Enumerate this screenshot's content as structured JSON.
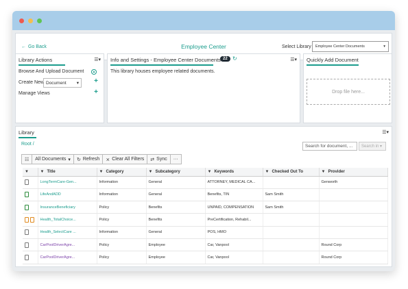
{
  "titlebar": {},
  "topbar": {
    "back_label": "Go Back",
    "title": "Employee Center",
    "select_library_label": "Select Library",
    "select_library_value": "Employee Center Documents"
  },
  "library_actions": {
    "title": "Library Actions",
    "browse_upload": "Browse And Upload Document",
    "create_new": "Create New",
    "create_new_value": "Document",
    "manage_views": "Manage Views"
  },
  "info_settings": {
    "title": "Info and Settings - Employee Center Documents",
    "badge": "22",
    "description": "This library houses employee related documents."
  },
  "quick_add": {
    "title": "Quickly Add Document",
    "dropzone": "Drop file here..."
  },
  "library": {
    "title": "Library",
    "breadcrumb": "Root /",
    "search_placeholder": "Search for document, ...",
    "search_button": "Search in ▾",
    "toolbar": {
      "all_documents": "All Documents",
      "refresh": "Refresh",
      "clear_filters": "Clear All Filters",
      "sync": "Sync",
      "more": "···"
    },
    "columns": [
      "Title",
      "Category",
      "Subcategory",
      "Keywords",
      "Checked Out To",
      "Provider"
    ],
    "rows": [
      {
        "icon": "doc",
        "icon2": "",
        "title": "LongTermCare-Gen...",
        "title_color": "green",
        "category": "Information",
        "subcategory": "General",
        "keywords": "ATTORNEY, MEDICAL CA...",
        "checked_out": "",
        "provider": "Genworth"
      },
      {
        "icon": "doc-green",
        "icon2": "",
        "title": "LifeAndADD",
        "title_color": "green",
        "category": "Information",
        "subcategory": "General",
        "keywords": "Benefits, TIN",
        "checked_out": "Sam Smith",
        "provider": ""
      },
      {
        "icon": "doc-green",
        "icon2": "",
        "title": "InsuranceBeneficiary",
        "title_color": "green",
        "category": "Policy",
        "subcategory": "Benefits",
        "keywords": "UNPAID, COMPENSATION",
        "checked_out": "Sam Smith",
        "provider": ""
      },
      {
        "icon": "doc-orange",
        "icon2": "doc-orange",
        "title": "Health_TotalChoice...",
        "title_color": "green",
        "category": "Policy",
        "subcategory": "Benefits",
        "keywords": "PreCertification, Rehabil...",
        "checked_out": "",
        "provider": ""
      },
      {
        "icon": "doc",
        "icon2": "",
        "title": "Health_SelectCare ...",
        "title_color": "green",
        "category": "Information",
        "subcategory": "General",
        "keywords": "POS, HMO",
        "checked_out": "",
        "provider": ""
      },
      {
        "icon": "doc",
        "icon2": "",
        "title": "CarPoolDriverAgre...",
        "title_color": "purple",
        "category": "Policy",
        "subcategory": "Employee",
        "keywords": "Car, Vanpool",
        "checked_out": "",
        "provider": "Round Corp"
      },
      {
        "icon": "doc",
        "icon2": "",
        "title": "CarPoolDriverAgre...",
        "title_color": "purple",
        "category": "Policy",
        "subcategory": "Employee",
        "keywords": "Car, Vanpool",
        "checked_out": "",
        "provider": "Round Corp"
      }
    ]
  },
  "colors": {
    "accent": "#1a9c8c",
    "titlebar": "#a8cde9",
    "purple_link": "#7b3fa8"
  }
}
